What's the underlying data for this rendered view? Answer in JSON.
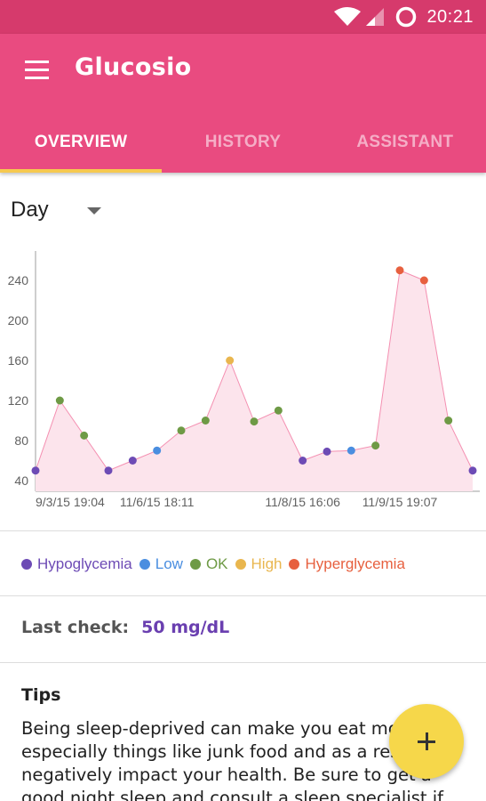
{
  "status_bar": {
    "time": "20:21"
  },
  "app": {
    "title": "Glucosio"
  },
  "tabs": [
    {
      "label": "OVERVIEW",
      "active": true
    },
    {
      "label": "HISTORY",
      "active": false
    },
    {
      "label": "ASSISTANT",
      "active": false
    }
  ],
  "range_select": {
    "value": "Day"
  },
  "chart_data": {
    "type": "area",
    "y_ticks": [
      40,
      80,
      120,
      160,
      200,
      240
    ],
    "ylim": [
      30,
      268
    ],
    "x_tick_labels": [
      "9/3/15 19:04",
      "11/6/15 18:11",
      "11/8/15 16:06",
      "11/9/15 19:07"
    ],
    "x_tick_indices": [
      0,
      5,
      11,
      15
    ],
    "values": [
      50,
      120,
      85,
      50,
      60,
      70,
      90,
      100,
      160,
      99,
      110,
      60,
      69,
      70,
      75,
      250,
      240,
      100,
      50
    ],
    "point_categories": [
      "Hypoglycemia",
      "OK",
      "OK",
      "Hypoglycemia",
      "Hypoglycemia",
      "Low",
      "OK",
      "OK",
      "High",
      "OK",
      "OK",
      "Hypoglycemia",
      "Hypoglycemia",
      "Low",
      "OK",
      "Hyperglycemia",
      "Hyperglycemia",
      "OK",
      "Hypoglycemia"
    ],
    "fill_color": "#fce4ec",
    "line_color": "#f48fb1"
  },
  "legend": [
    {
      "label": "Hypoglycemia",
      "color": "#6d4bb5"
    },
    {
      "label": "Low",
      "color": "#4a8ee0"
    },
    {
      "label": "OK",
      "color": "#6e9a45"
    },
    {
      "label": "High",
      "color": "#e9b64e"
    },
    {
      "label": "Hyperglycemia",
      "color": "#e7603f"
    }
  ],
  "last_check": {
    "label": "Last check:",
    "value": "50 mg/dL"
  },
  "tips": {
    "title": "Tips",
    "body": "Being sleep-deprived can make you eat more especially things like junk food and as a result negatively impact your health. Be sure to get a good night sleep and consult a sleep specialist if you are"
  },
  "fab": {
    "icon": "plus-icon"
  },
  "colors": {
    "primary": "#e94b80",
    "primary_dark": "#d63a6c",
    "accent": "#f6d74a"
  }
}
